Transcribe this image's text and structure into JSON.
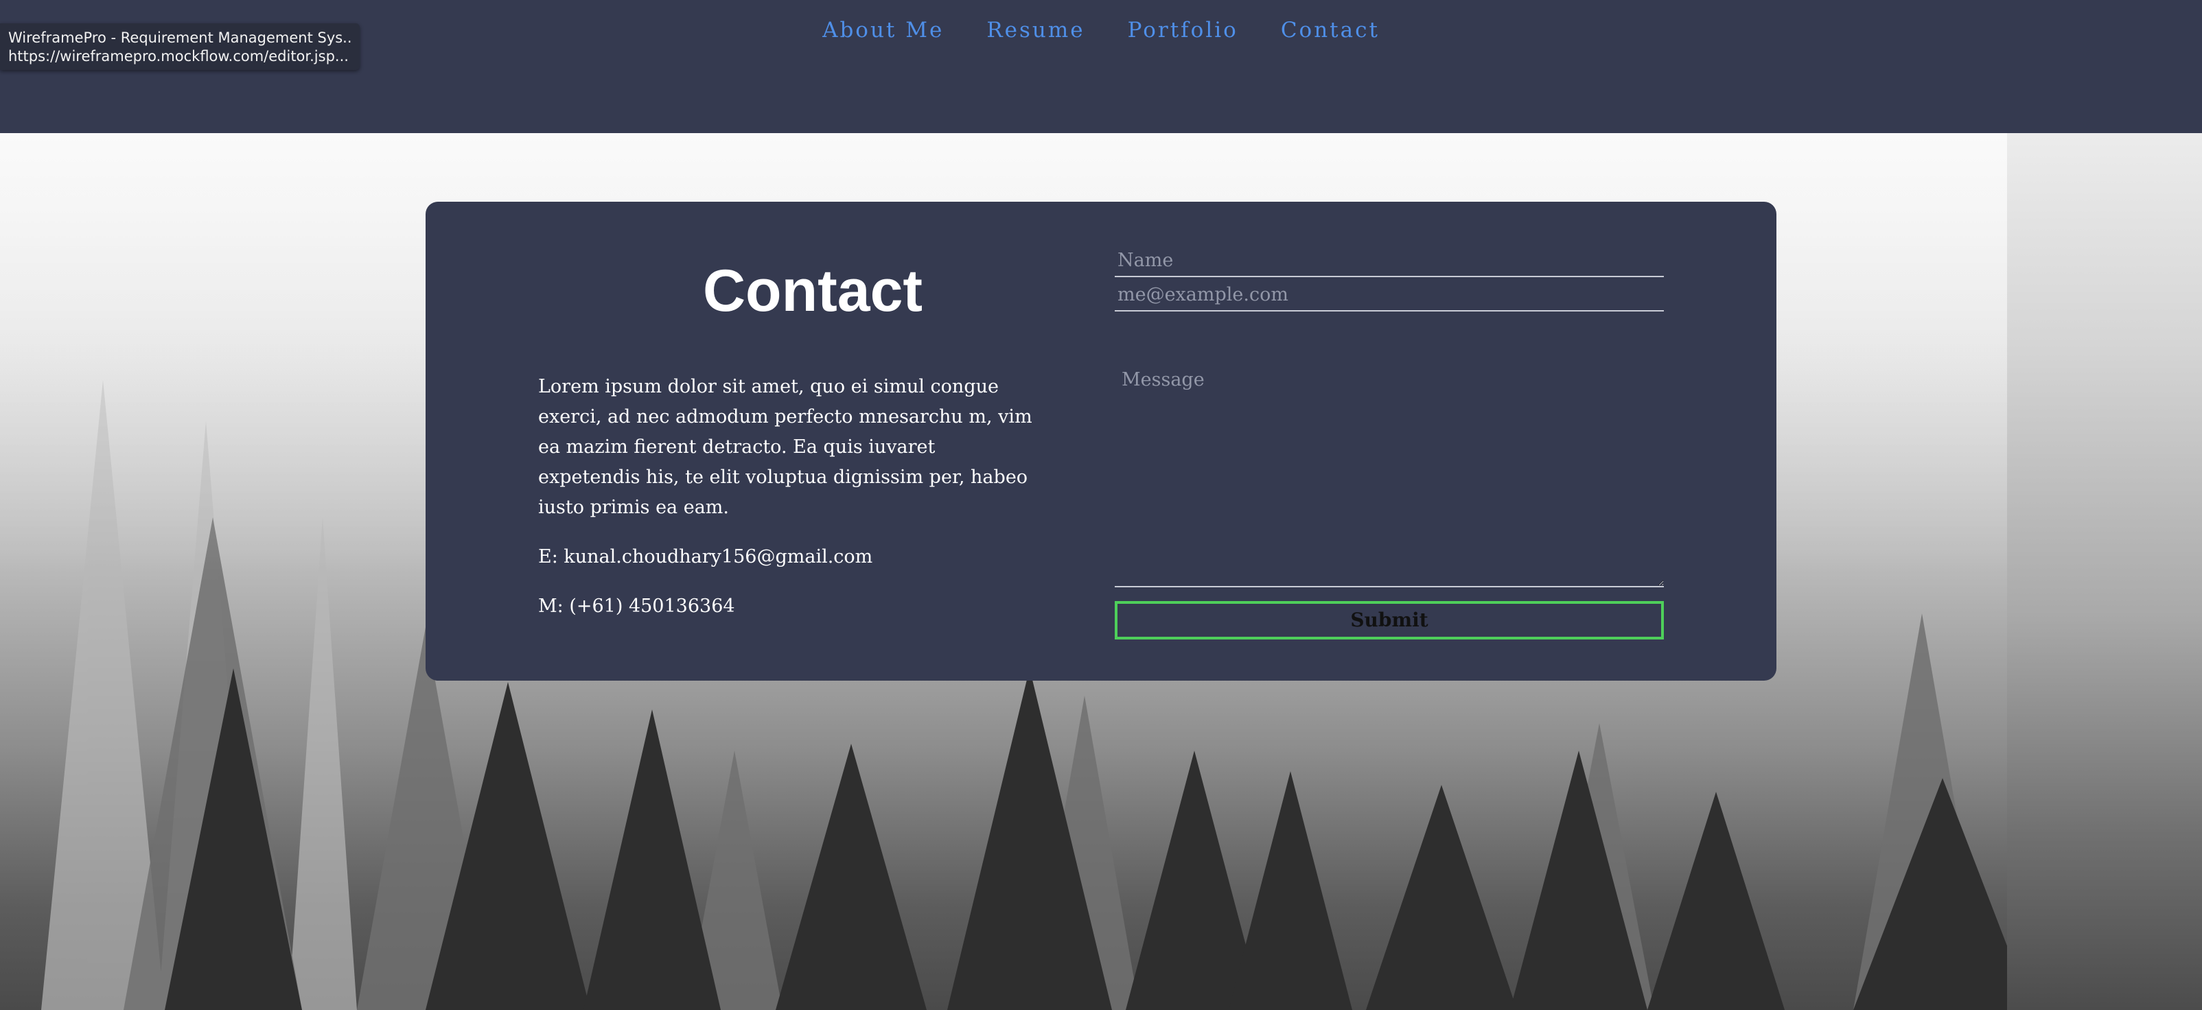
{
  "tooltip": {
    "title": "WireframePro - Requirement Management Sys...",
    "url": "https://wireframepro.mockflow.com/editor.jsp..."
  },
  "nav": {
    "items": [
      {
        "label": "About Me"
      },
      {
        "label": "Resume"
      },
      {
        "label": "Portfolio"
      },
      {
        "label": "Contact"
      }
    ]
  },
  "contact": {
    "title": "Contact",
    "body": "Lorem ipsum dolor sit amet, quo ei simul congue exerci, ad nec admodum perfecto mnesarchu m, vim ea mazim fierent detracto. Ea quis iuvaret expetendis his, te elit voluptua dignissim per, habeo iusto primis ea eam.",
    "email_line": "E: kunal.choudhary156@gmail.com",
    "phone_line": "M: (+61) 450136364"
  },
  "form": {
    "name_placeholder": "Name",
    "email_placeholder": "me@example.com",
    "message_placeholder": "Message",
    "submit_label": "Submit"
  },
  "colors": {
    "header_bg": "#353a50",
    "nav_link": "#4f8fe8",
    "card_bg": "#353a50",
    "submit_border": "#4ecf5a"
  },
  "icons": {
    "textarea_resize": "resize-handle-icon"
  }
}
